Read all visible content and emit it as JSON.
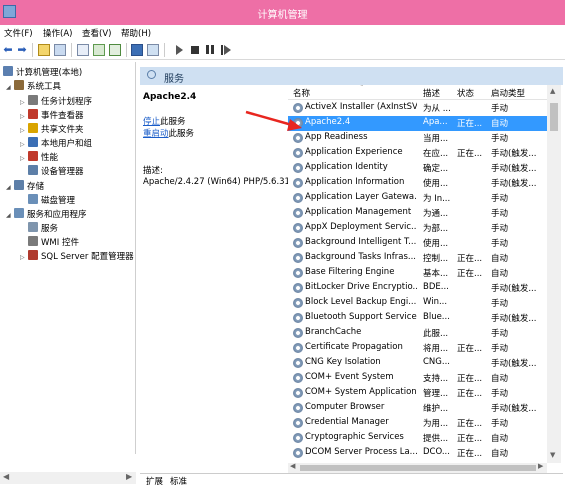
{
  "window": {
    "title": "计算机管理"
  },
  "menu": [
    "文件(F)",
    "操作(A)",
    "查看(V)",
    "帮助(H)"
  ],
  "tree": [
    {
      "label": "计算机管理(本地)",
      "icon": "computer-icon",
      "color": "#5b7fb0"
    },
    {
      "label": "系统工具",
      "icon": "tools-icon",
      "color": "#8b6a3a"
    },
    {
      "label": "任务计划程序",
      "icon": "clock-icon",
      "color": "#7a7a7a"
    },
    {
      "label": "事件查看器",
      "icon": "event-viewer-icon",
      "color": "#c0392b"
    },
    {
      "label": "共享文件夹",
      "icon": "shared-folder-icon",
      "color": "#d9a400"
    },
    {
      "label": "本地用户和组",
      "icon": "users-icon",
      "color": "#3c6fb5"
    },
    {
      "label": "性能",
      "icon": "performance-icon",
      "color": "#c0392b"
    },
    {
      "label": "设备管理器",
      "icon": "device-manager-icon",
      "color": "#5d7fa8"
    },
    {
      "label": "存储",
      "icon": "storage-icon",
      "color": "#5d7fa8"
    },
    {
      "label": "磁盘管理",
      "icon": "disk-icon",
      "color": "#6a8fb8"
    },
    {
      "label": "服务和应用程序",
      "icon": "services-apps-icon",
      "color": "#6a8fb8"
    },
    {
      "label": "服务",
      "icon": "gear-icon",
      "color": "#7f95ad"
    },
    {
      "label": "WMI 控件",
      "icon": "wmi-icon",
      "color": "#7a7a7a"
    },
    {
      "label": "SQL Server 配置管理器",
      "icon": "sql-server-icon",
      "color": "#b03a2e"
    }
  ],
  "panel": {
    "title": "服务",
    "selected_name": "Apache2.4",
    "stop_link": "停止",
    "stop_suffix": "此服务",
    "restart_link": "重启动",
    "restart_suffix": "此服务",
    "desc_label": "描述:",
    "desc_text": "Apache/2.4.27 (Win64) PHP/5.6.31"
  },
  "columns": {
    "name": "名称",
    "desc": "描述",
    "state": "状态",
    "start": "启动类型"
  },
  "services": [
    {
      "name": "ActiveX Installer (AxInstSV)",
      "desc": "为从 ...",
      "state": "",
      "start": "手动"
    },
    {
      "name": "Apache2.4",
      "desc": "Apa...",
      "state": "正在...",
      "start": "自动"
    },
    {
      "name": "App Readiness",
      "desc": "当用...",
      "state": "",
      "start": "手动"
    },
    {
      "name": "Application Experience",
      "desc": "在应...",
      "state": "正在...",
      "start": "手动(触发..."
    },
    {
      "name": "Application Identity",
      "desc": "确定...",
      "state": "",
      "start": "手动(触发..."
    },
    {
      "name": "Application Information",
      "desc": "使用...",
      "state": "",
      "start": "手动(触发..."
    },
    {
      "name": "Application Layer Gatewa...",
      "desc": "为 In...",
      "state": "",
      "start": "手动"
    },
    {
      "name": "Application Management",
      "desc": "为通...",
      "state": "",
      "start": "手动"
    },
    {
      "name": "AppX Deployment Servic...",
      "desc": "为部...",
      "state": "",
      "start": "手动"
    },
    {
      "name": "Background Intelligent T...",
      "desc": "使用...",
      "state": "",
      "start": "手动"
    },
    {
      "name": "Background Tasks Infras...",
      "desc": "控制...",
      "state": "正在...",
      "start": "自动"
    },
    {
      "name": "Base Filtering Engine",
      "desc": "基本...",
      "state": "正在...",
      "start": "自动"
    },
    {
      "name": "BitLocker Drive Encryptio...",
      "desc": "BDE...",
      "state": "",
      "start": "手动(触发..."
    },
    {
      "name": "Block Level Backup Engi...",
      "desc": "Win...",
      "state": "",
      "start": "手动"
    },
    {
      "name": "Bluetooth Support Service",
      "desc": "Blue...",
      "state": "",
      "start": "手动(触发..."
    },
    {
      "name": "BranchCache",
      "desc": "此服...",
      "state": "",
      "start": "手动"
    },
    {
      "name": "Certificate Propagation",
      "desc": "将用...",
      "state": "正在...",
      "start": "手动"
    },
    {
      "name": "CNG Key Isolation",
      "desc": "CNG...",
      "state": "",
      "start": "手动(触发..."
    },
    {
      "name": "COM+ Event System",
      "desc": "支持...",
      "state": "正在...",
      "start": "自动"
    },
    {
      "name": "COM+ System Application",
      "desc": "管理...",
      "state": "正在...",
      "start": "手动"
    },
    {
      "name": "Computer Browser",
      "desc": "维护...",
      "state": "",
      "start": "手动(触发..."
    },
    {
      "name": "Credential Manager",
      "desc": "为用...",
      "state": "正在...",
      "start": "手动"
    },
    {
      "name": "Cryptographic Services",
      "desc": "提供...",
      "state": "正在...",
      "start": "自动"
    },
    {
      "name": "DCOM Server Process La...",
      "desc": "DCO...",
      "state": "正在...",
      "start": "自动"
    }
  ],
  "tabs": [
    "扩展",
    "标准"
  ],
  "colors": {
    "titlebar": "#ee6fa6",
    "selection": "#3399ff",
    "annotation_arrow": "#e8261f"
  }
}
